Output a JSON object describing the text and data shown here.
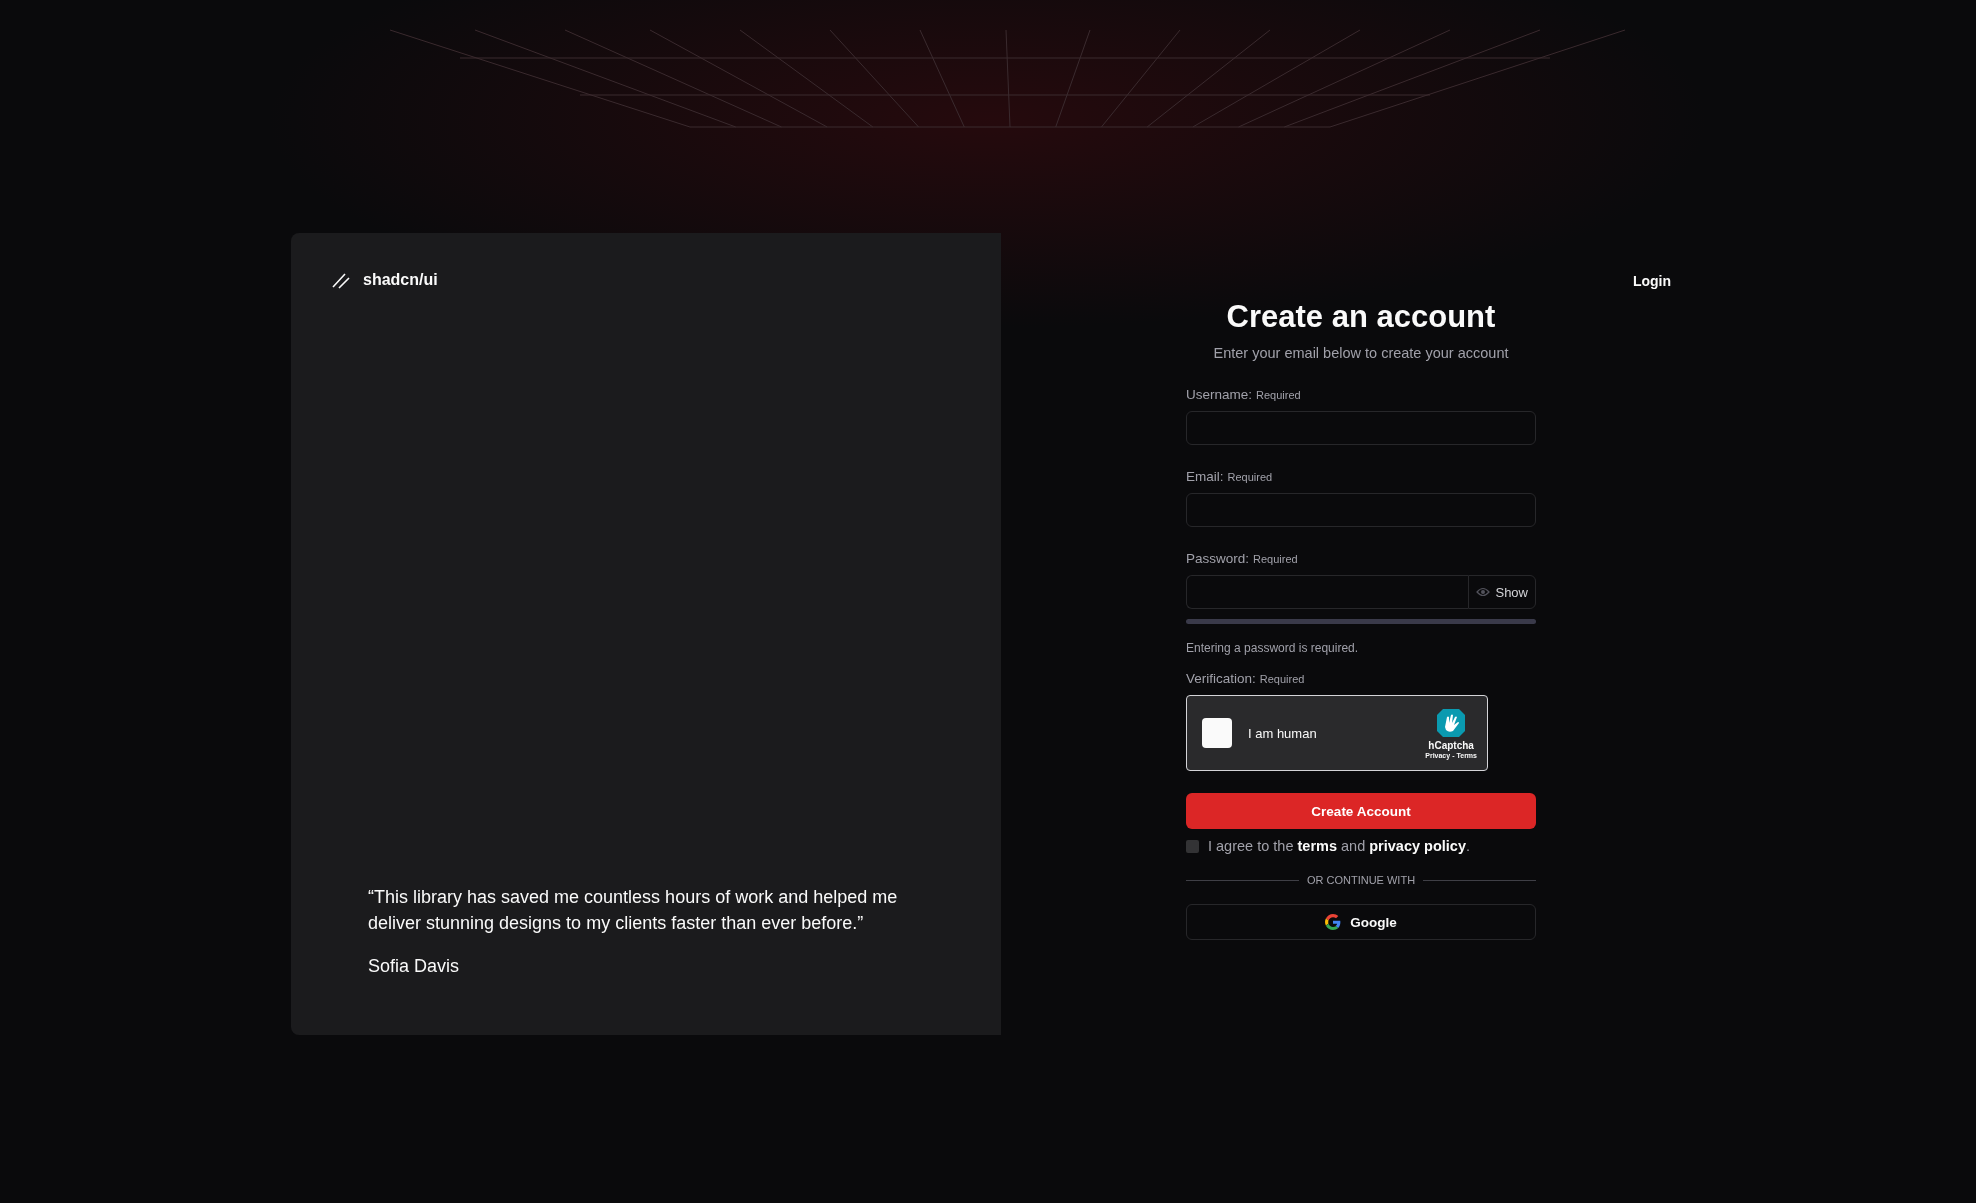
{
  "brand": {
    "name": "shadcn/ui"
  },
  "testimonial": {
    "quote": "“This library has saved me countless hours of work and helped me deliver stunning designs to my clients faster than ever before.”",
    "author": "Sofia Davis"
  },
  "header": {
    "login": "Login"
  },
  "form": {
    "title": "Create an account",
    "subtitle": "Enter your email below to create your account",
    "fields": [
      {
        "kind": "text",
        "label": "Username:",
        "hint": "Required"
      },
      {
        "kind": "text",
        "label": "Email:",
        "hint": "Required"
      },
      {
        "kind": "password",
        "label": "Password:",
        "hint": "Required",
        "toggle": "Show",
        "strength": {
          "level": 0
        },
        "error": "Entering a password is required."
      }
    ],
    "verification": {
      "label": "Verification:",
      "hint": "Required",
      "checkbox_label": "I am human",
      "checked": false,
      "brand": "hCaptcha",
      "links": [
        "Privacy",
        "Terms"
      ],
      "separator": "-"
    },
    "submit": "Create Account",
    "agree": {
      "checked": false,
      "parts": [
        {
          "kind": "text",
          "text": "I agree to the "
        },
        {
          "kind": "link",
          "text": "terms"
        },
        {
          "kind": "text",
          "text": " and "
        },
        {
          "kind": "link",
          "text": "privacy policy"
        },
        {
          "kind": "text",
          "text": "."
        }
      ]
    },
    "divider": "OR CONTINUE WITH",
    "social": [
      {
        "kind": "google",
        "label": "Google"
      }
    ]
  }
}
